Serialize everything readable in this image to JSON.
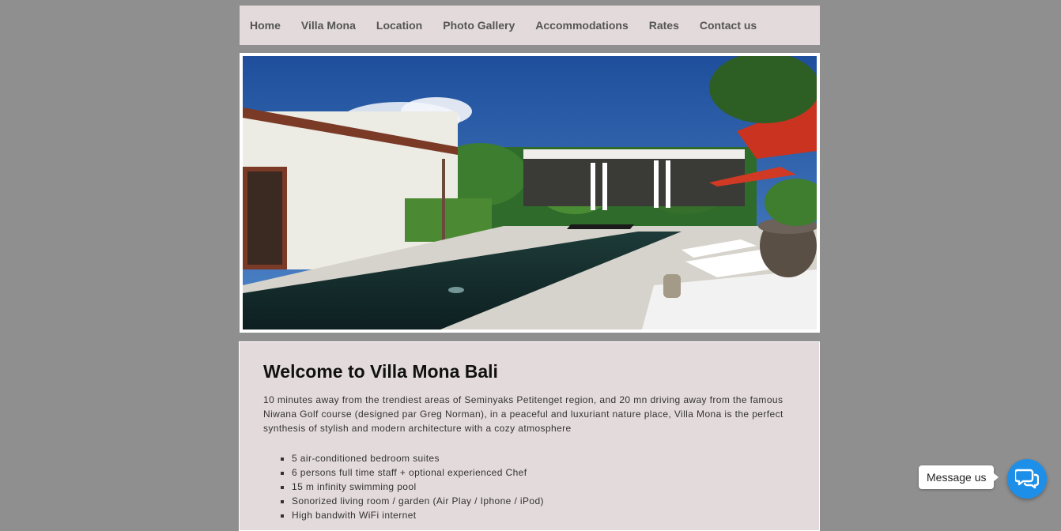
{
  "nav": {
    "items": [
      {
        "label": "Home"
      },
      {
        "label": "Villa Mona"
      },
      {
        "label": "Location"
      },
      {
        "label": "Photo Gallery"
      },
      {
        "label": "Accommodations"
      },
      {
        "label": "Rates"
      },
      {
        "label": "Contact us"
      }
    ]
  },
  "hero": {
    "icon": "villa-pool-photo"
  },
  "main": {
    "title": "Welcome to Villa Mona Bali",
    "intro": "10 minutes away from the trendiest areas of Seminyaks Petitenget region, and 20 mn driving away from the famous Niwana Golf course (designed par Greg Norman), in a peaceful and luxuriant nature place, Villa Mona is the perfect synthesis of stylish and modern architecture with a cozy atmosphere",
    "features": [
      "5 air-conditioned bedroom suites",
      "6 persons full time staff + optional experienced Chef",
      "15 m infinity swimming pool",
      "Sonorized living room / garden (Air Play / Iphone / iPod)",
      "High bandwith WiFi internet"
    ]
  },
  "chat": {
    "label": "Message us",
    "icon": "chat-bubbles-icon",
    "color": "#1d8fe8"
  }
}
